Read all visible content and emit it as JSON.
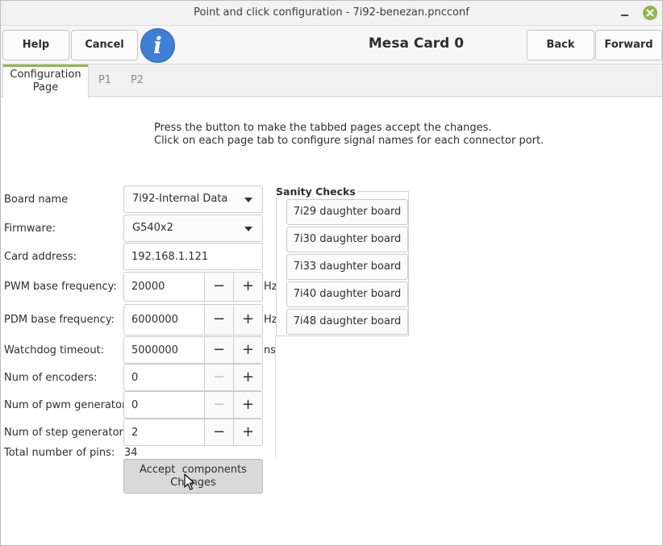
{
  "window": {
    "title": "Point and click configuration - 7i92-benezan.pncconf"
  },
  "toolbar": {
    "help_label": "Help",
    "cancel_label": "Cancel",
    "info_glyph": "i",
    "page_title": "Mesa Card 0",
    "back_label": "Back",
    "forward_label": "Forward"
  },
  "tabs": [
    {
      "line1": "Configuration",
      "line2": "Page",
      "active": true
    },
    {
      "line1": "P1",
      "active": false
    },
    {
      "line1": "P2",
      "active": false
    }
  ],
  "instructions": {
    "line1": "Press the button to make the tabbed pages accept the changes.",
    "line2": "Click on each page tab to configure signal names for each connector port."
  },
  "form": {
    "board_name_label": "Board name",
    "board_name_value": "7i92-Internal Data",
    "firmware_label": "Firmware:",
    "firmware_value": "G540x2",
    "card_address_label": "Card address:",
    "card_address_value": "192.168.1.121",
    "pwm_freq_label": "PWM base frequency:",
    "pwm_freq_value": "20000",
    "pwm_freq_unit": "Hz",
    "pdm_freq_label": "PDM base frequency:",
    "pdm_freq_value": "6000000",
    "pdm_freq_unit": "Hz",
    "watchdog_label": "Watchdog timeout:",
    "watchdog_value": "5000000",
    "watchdog_unit": "ns",
    "encoders_label": "Num of encoders:",
    "encoders_value": "0",
    "pwm_gen_label": "Num of pwm generators:",
    "pwm_gen_value": "0",
    "step_gen_label": "Num of step generators:",
    "step_gen_value": "2",
    "total_pins_label": "Total number of pins:",
    "total_pins_value": "34",
    "accept_line1": "Accept  components",
    "accept_line2": "Changes",
    "minus": "−",
    "plus": "+"
  },
  "sanity": {
    "title": "Sanity Checks",
    "buttons": [
      "7i29 daughter board",
      "7i30 daughter board",
      "7i33 daughter board",
      "7i40 daughter board",
      "7i48 daughter board"
    ]
  },
  "colors": {
    "accent": "#8fb84f",
    "info_blue": "#3d7fd4"
  }
}
